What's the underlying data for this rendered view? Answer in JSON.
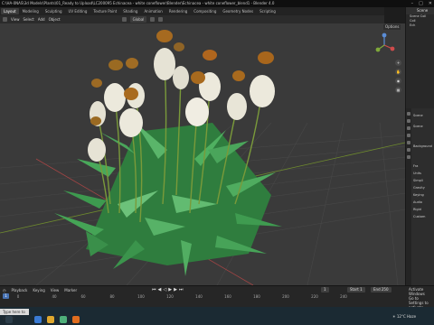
{
  "window": {
    "title": "C:\\HA-0NAS\\3d Models\\Plants\\01_Ready to Upload\\LC200095 Echinacea - white coneflower\\Blender\\Echinacea - white coneflower_blend1 - Blender 4.0"
  },
  "workspace_tabs": [
    "Layout",
    "Modeling",
    "Sculpting",
    "UV Editing",
    "Texture Paint",
    "Shading",
    "Animation",
    "Rendering",
    "Compositing",
    "Geometry Nodes",
    "Scripting"
  ],
  "viewport_header": {
    "menus": [
      "View",
      "Select",
      "Add",
      "Object"
    ],
    "transform_orientation": "Global",
    "options": "Options"
  },
  "outliner": {
    "header": "Scene",
    "rows": [
      "Scene Coll",
      "Coll",
      "Ech"
    ]
  },
  "properties": {
    "rows": [
      "Scene",
      "Scene",
      "Background",
      "Fra",
      "Units",
      "Simpli",
      "Gravity",
      "Keying",
      "Audio",
      "Rigid",
      "Custom"
    ]
  },
  "timeline": {
    "playback": "Playback",
    "keying": "Keying",
    "view": "View",
    "marker": "Marker",
    "current_frame": "1",
    "start_label": "Start",
    "start": "1",
    "end_label": "End",
    "end": "250",
    "ruler_ticks": [
      "0",
      "40",
      "60",
      "80",
      "100",
      "120",
      "140",
      "160",
      "180",
      "200",
      "220",
      "240"
    ]
  },
  "activate_windows": {
    "line1": "Activate Windows",
    "line2": "Go to Settings to activate"
  },
  "taskbar": {
    "search_placeholder": "Type here to search",
    "weather": "12°C Haze"
  },
  "colors": {
    "accent": "#4772b3",
    "petal": "#ece9dc",
    "cone": "#a86a1e",
    "leaf": "#3f9b50",
    "stem": "#6f8f35"
  }
}
